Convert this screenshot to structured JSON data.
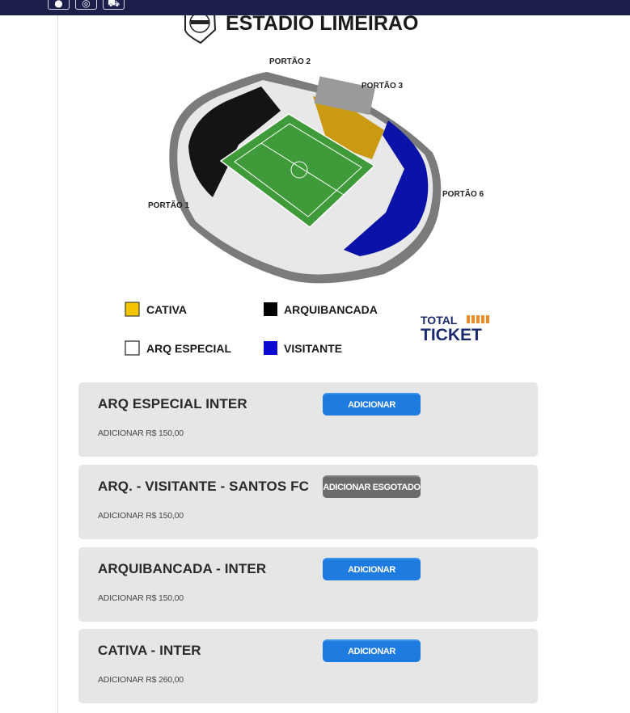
{
  "topbar": {
    "icons": [
      {
        "name": "facebook-icon",
        "glyph": "●"
      },
      {
        "name": "instagram-icon",
        "glyph": "◎"
      },
      {
        "name": "cart-icon",
        "glyph": "⛟"
      }
    ],
    "background": "#1b1f4a"
  },
  "stadium_map": {
    "title": "ESTADIO LIMEIRAO",
    "gates": {
      "gate1": "PORTÃO 1",
      "gate2": "PORTÃO 2",
      "gate3": "PORTÃO 3",
      "gate6": "PORTÃO 6"
    },
    "legend": [
      {
        "label": "CATIVA",
        "color": "#f5c400"
      },
      {
        "label": "ARQUIBANCADA",
        "color": "#000000"
      },
      {
        "label": "ARQ ESPECIAL",
        "color": "#ffffff"
      },
      {
        "label": "VISITANTE",
        "color": "#0a0ad0"
      }
    ],
    "brand_top": "TOTAL",
    "brand_bottom": "TICKET"
  },
  "tickets": [
    {
      "name": "ARQ ESPECIAL INTER",
      "price": "ADICIONAR R$ 150,00",
      "button": "ADICIONAR",
      "sold_out": false
    },
    {
      "name": "ARQ. - VISITANTE - SANTOS FC",
      "price": "ADICIONAR R$ 150,00",
      "button": "ADICIONAR ESGOTADO",
      "sold_out": true
    },
    {
      "name": "ARQUIBANCADA - INTER",
      "price": "ADICIONAR R$ 150,00",
      "button": "ADICIONAR",
      "sold_out": false
    },
    {
      "name": "CATIVA - INTER",
      "price": "ADICIONAR R$ 260,00",
      "button": "ADICIONAR",
      "sold_out": false
    }
  ],
  "colors": {
    "button_blue": "#1e7be0",
    "button_soldout": "#6b6b6b",
    "card_bg": "#e6e6e6"
  }
}
